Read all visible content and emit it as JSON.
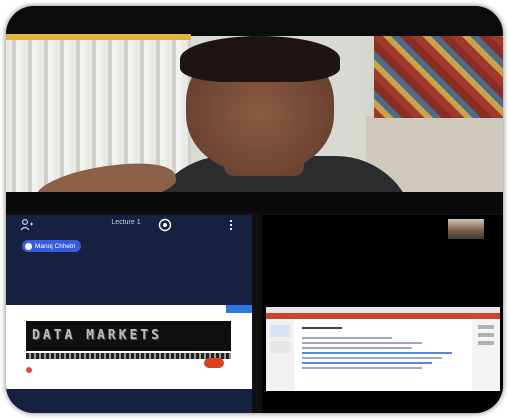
{
  "classroom": {
    "header": {
      "title": "Lecture 1",
      "people_icon": "people-icon",
      "camera_icon": "camera-icon",
      "menu_icon": "more-vertical-icon"
    },
    "participant_chip": {
      "name": "Manoj Chhetri",
      "icon": "mic-icon"
    },
    "whiteboard": {
      "text": "DATA MARKETS"
    }
  },
  "colors": {
    "app_background": "#16203f",
    "chip": "#3c5bd9",
    "accent_blue": "#2b78e4",
    "badge": "#d6421f",
    "ribbon": "#c8452e"
  }
}
